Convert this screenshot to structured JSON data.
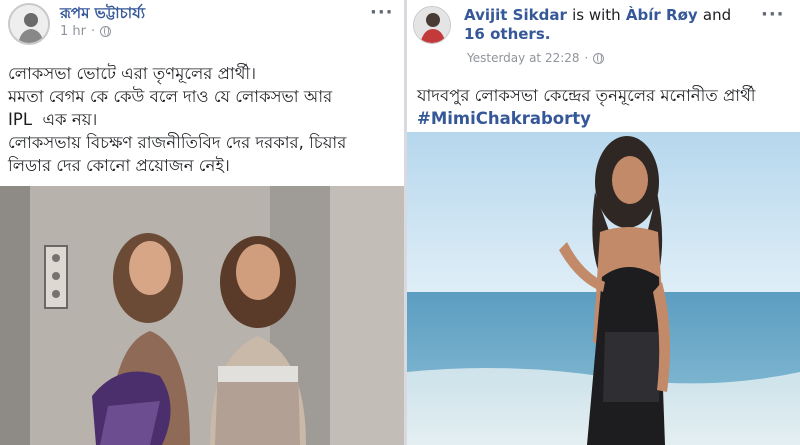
{
  "post_left": {
    "author": "রূপম ভট্টাচার্য্য",
    "timestamp": "1 hr",
    "more_icon": "more-dots-icon",
    "privacy_icon": "globe-icon",
    "text_lines": [
      "লোকসভা ভোটে এরা তৃণমূলের প্রার্থী।",
      "মমতা বেগম কে কেউ বলে দাও যে লোকসভা আর",
      "IPL  এক নয়।",
      "লোকসভায় বিচক্ষণ রাজনীতিবিদ দের দরকার, চিয়ার",
      "লিডার দের কোনো প্রয়োজন নেই।"
    ]
  },
  "post_right": {
    "author": "Avijit Sikdar",
    "with_text": "is with",
    "tagged": "Àbír Røy",
    "and_text": "and",
    "others": "16 others.",
    "timestamp": "Yesterday at 22:28",
    "more_icon": "more-dots-icon",
    "privacy_icon": "globe-icon",
    "text": "যাদবপুর লোকসভা কেন্দ্রের তৃনমূলের মনোনীত প্রার্থী",
    "hashtag": "#MimiChakraborty"
  }
}
